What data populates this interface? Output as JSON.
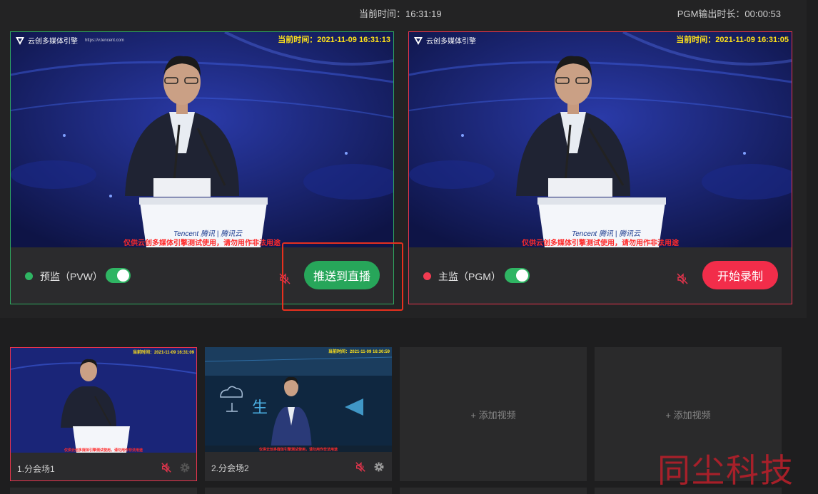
{
  "header": {
    "current_time": "当前时间：16:31:19",
    "pgm_duration": "PGM输出时长：00:00:53"
  },
  "preview": {
    "label": "预监（PVW）",
    "enabled": true,
    "timestamp": "当前时间：2021-11-09 16:31:13",
    "watermark": "仅供云创多媒体引擎测试使用，请勿用作非法用途",
    "logo_text": "云创多媒体引擎",
    "logo_url": "https://v.tencent.com",
    "action_label": "推送到直播",
    "status_color": "#2fb563"
  },
  "program": {
    "label": "主监（PGM）",
    "enabled": true,
    "timestamp": "当前时间：2021-11-09 16:31:05",
    "watermark": "仅供云创多媒体引擎测试使用，请勿用作非法用途",
    "logo_text": "云创多媒体引擎",
    "action_label": "开始录制",
    "status_color": "#f23b51"
  },
  "sources": [
    {
      "name": "1.分会场1",
      "timestamp": "当前时间：2021-11-09 16:31:09",
      "watermark": "仅供云创多媒体引擎测试使用，请勿用作非法用途",
      "selected": true
    },
    {
      "name": "2.分会场2",
      "timestamp": "当前时间：2021-11-09 16:30:59",
      "watermark": "仅供云创多媒体引擎测试使用，请勿用作非法用途",
      "selected": false
    },
    {
      "add_label": "+ 添加视频"
    },
    {
      "add_label": "+ 添加视频"
    }
  ],
  "brand_watermark": "同尘科技",
  "stage_logo": "Tencent 腾讯 | 腾讯云",
  "icons": {
    "mute": "speaker-muted-icon",
    "settings": "gear-icon",
    "logo": "triangle-logo-icon"
  },
  "colors": {
    "accent_green": "#27a65a",
    "accent_red": "#f22d4a",
    "highlight": "#e8301e"
  }
}
